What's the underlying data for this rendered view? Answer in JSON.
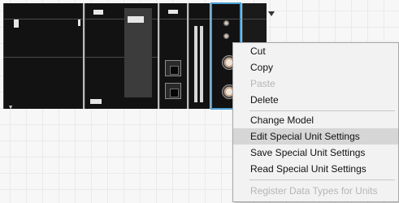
{
  "context_menu": {
    "items": [
      {
        "label": "Cut",
        "enabled": true
      },
      {
        "label": "Copy",
        "enabled": true
      },
      {
        "label": "Paste",
        "enabled": false
      },
      {
        "label": "Delete",
        "enabled": true
      },
      {
        "label": "Change Model",
        "enabled": true
      },
      {
        "label": "Edit Special Unit Settings",
        "enabled": true,
        "highlighted": true
      },
      {
        "label": "Save Special Unit Settings",
        "enabled": true
      },
      {
        "label": "Read Special Unit Settings",
        "enabled": true
      },
      {
        "label": "Register Data Types for Units",
        "enabled": false
      }
    ]
  },
  "colors": {
    "selection_outline": "#4b9fd4",
    "menu_background": "#f2f2f2",
    "disabled_text": "#b5b5b5",
    "highlight": "#d6d6d6"
  },
  "icons": [
    "dropdown-arrow-icon"
  ]
}
